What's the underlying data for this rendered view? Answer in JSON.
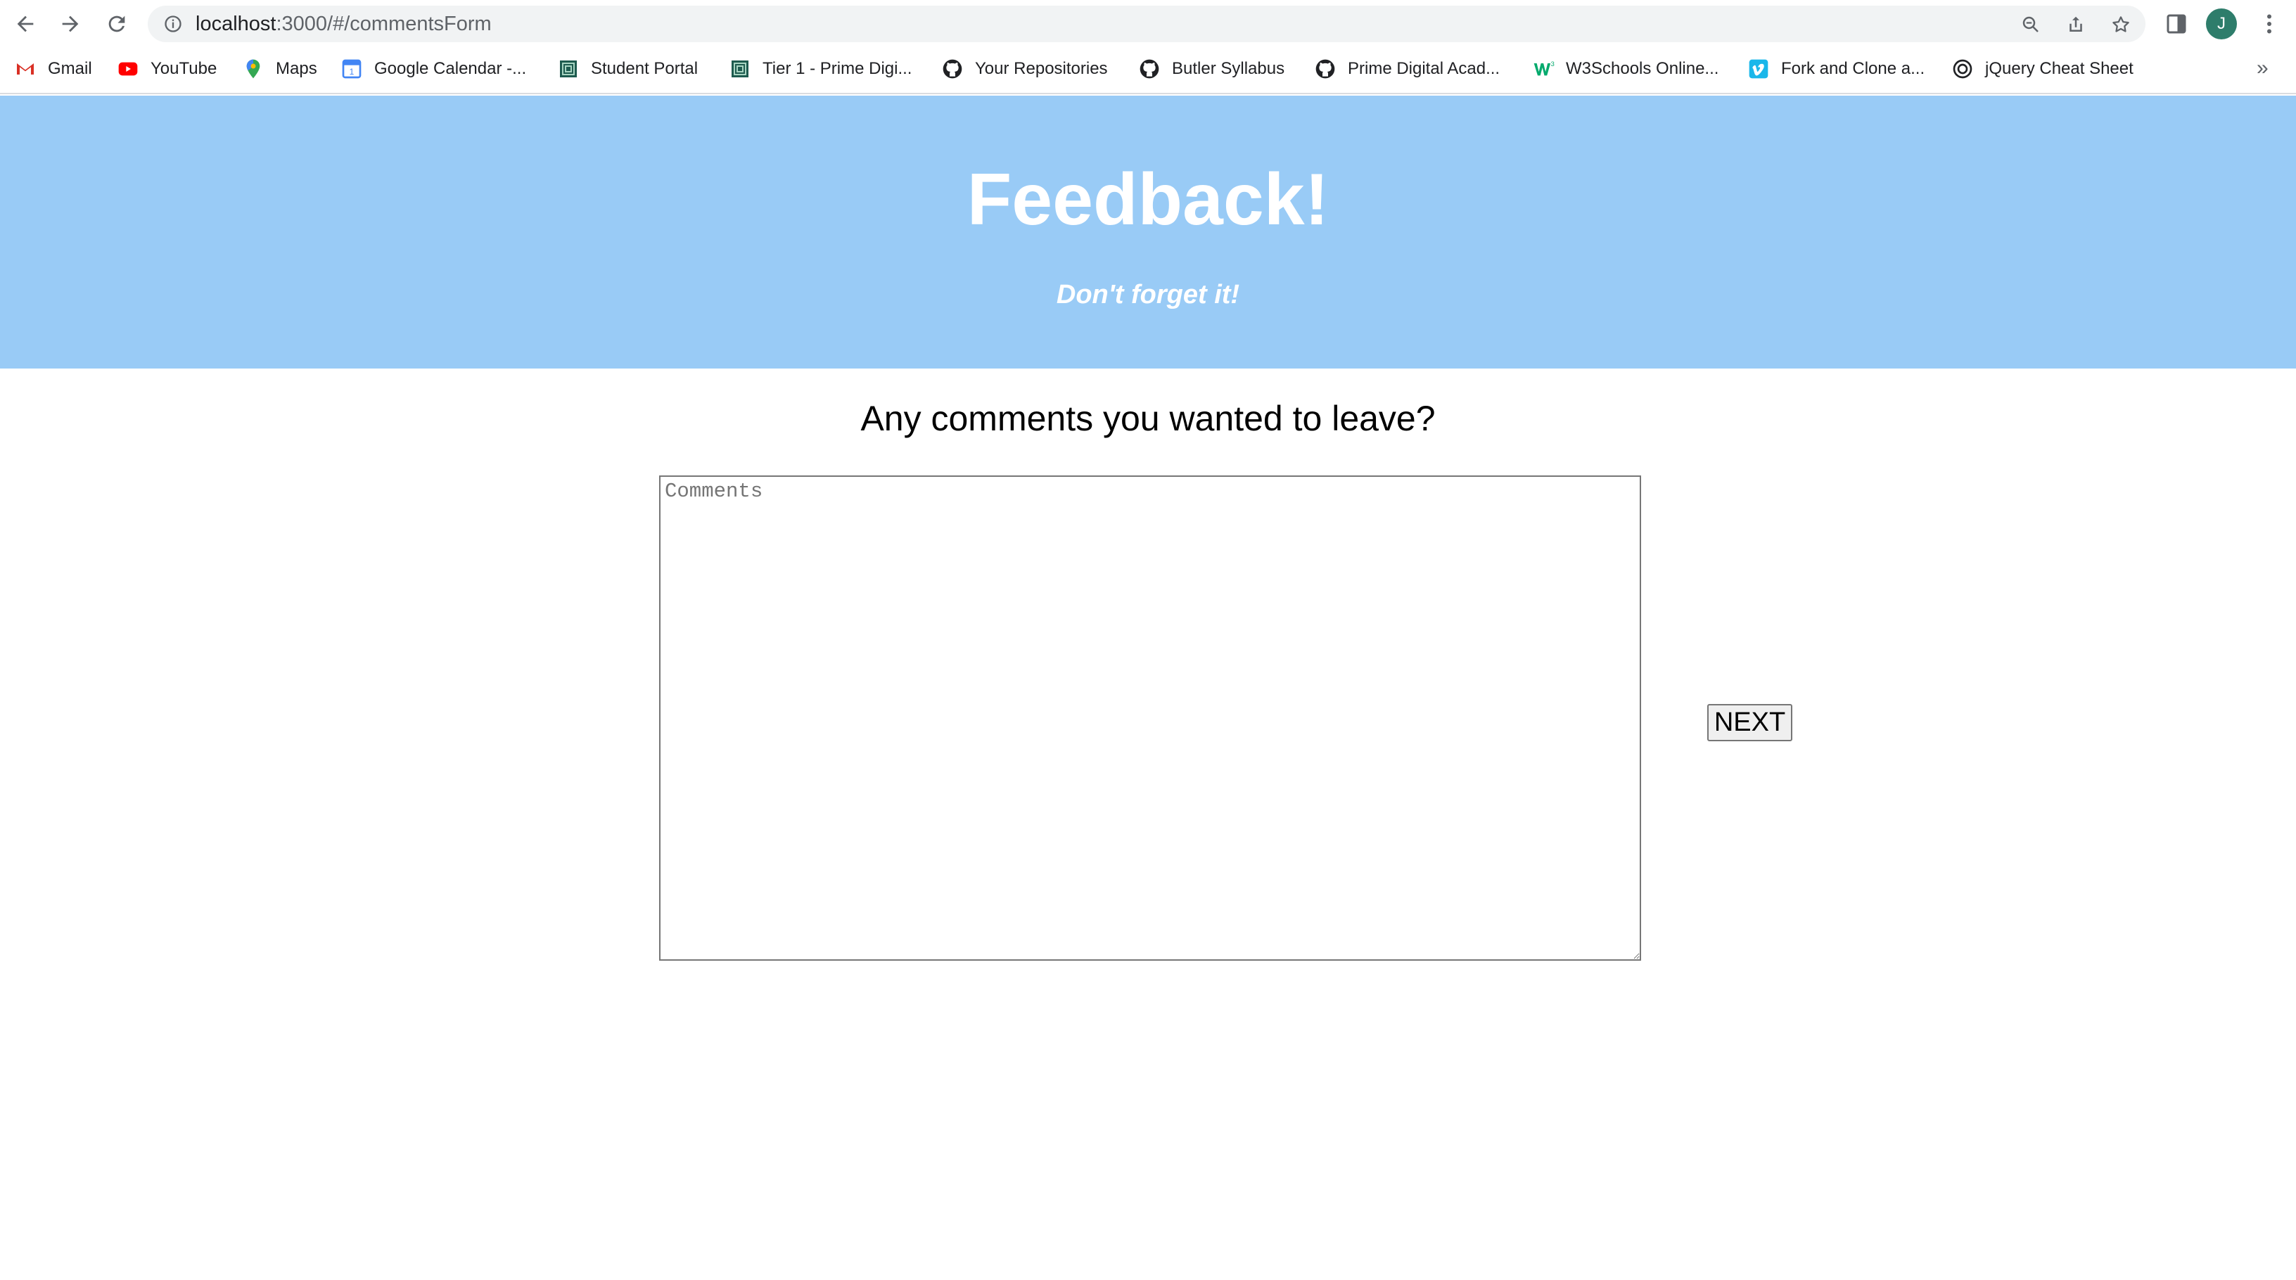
{
  "browser": {
    "url_host": "localhost",
    "url_path": ":3000/#/commentsForm",
    "profile_initial": "J",
    "bookmarks": [
      {
        "label": "Gmail",
        "icon": "gmail-icon"
      },
      {
        "label": "YouTube",
        "icon": "youtube-icon"
      },
      {
        "label": "Maps",
        "icon": "maps-icon"
      },
      {
        "label": "Google Calendar -...",
        "icon": "calendar-icon"
      },
      {
        "label": "Student Portal",
        "icon": "portal-icon"
      },
      {
        "label": "Tier 1 - Prime Digi...",
        "icon": "portal-icon"
      },
      {
        "label": "Your Repositories",
        "icon": "github-icon"
      },
      {
        "label": "Butler Syllabus",
        "icon": "github-icon"
      },
      {
        "label": "Prime Digital Acad...",
        "icon": "github-icon"
      },
      {
        "label": "W3Schools Online...",
        "icon": "w3schools-icon"
      },
      {
        "label": "Fork and Clone a...",
        "icon": "vimeo-icon"
      },
      {
        "label": "jQuery Cheat Sheet",
        "icon": "circle-icon"
      }
    ],
    "more_bookmarks": "»"
  },
  "header": {
    "title": "Feedback!",
    "subtitle": "Don't forget it!"
  },
  "form": {
    "question": "Any comments you wanted to leave?",
    "comments_placeholder": "Comments",
    "comments_value": "",
    "next_label": "NEXT"
  },
  "colors": {
    "header_bg": "#99cbf6",
    "header_text": "#ffffff"
  }
}
